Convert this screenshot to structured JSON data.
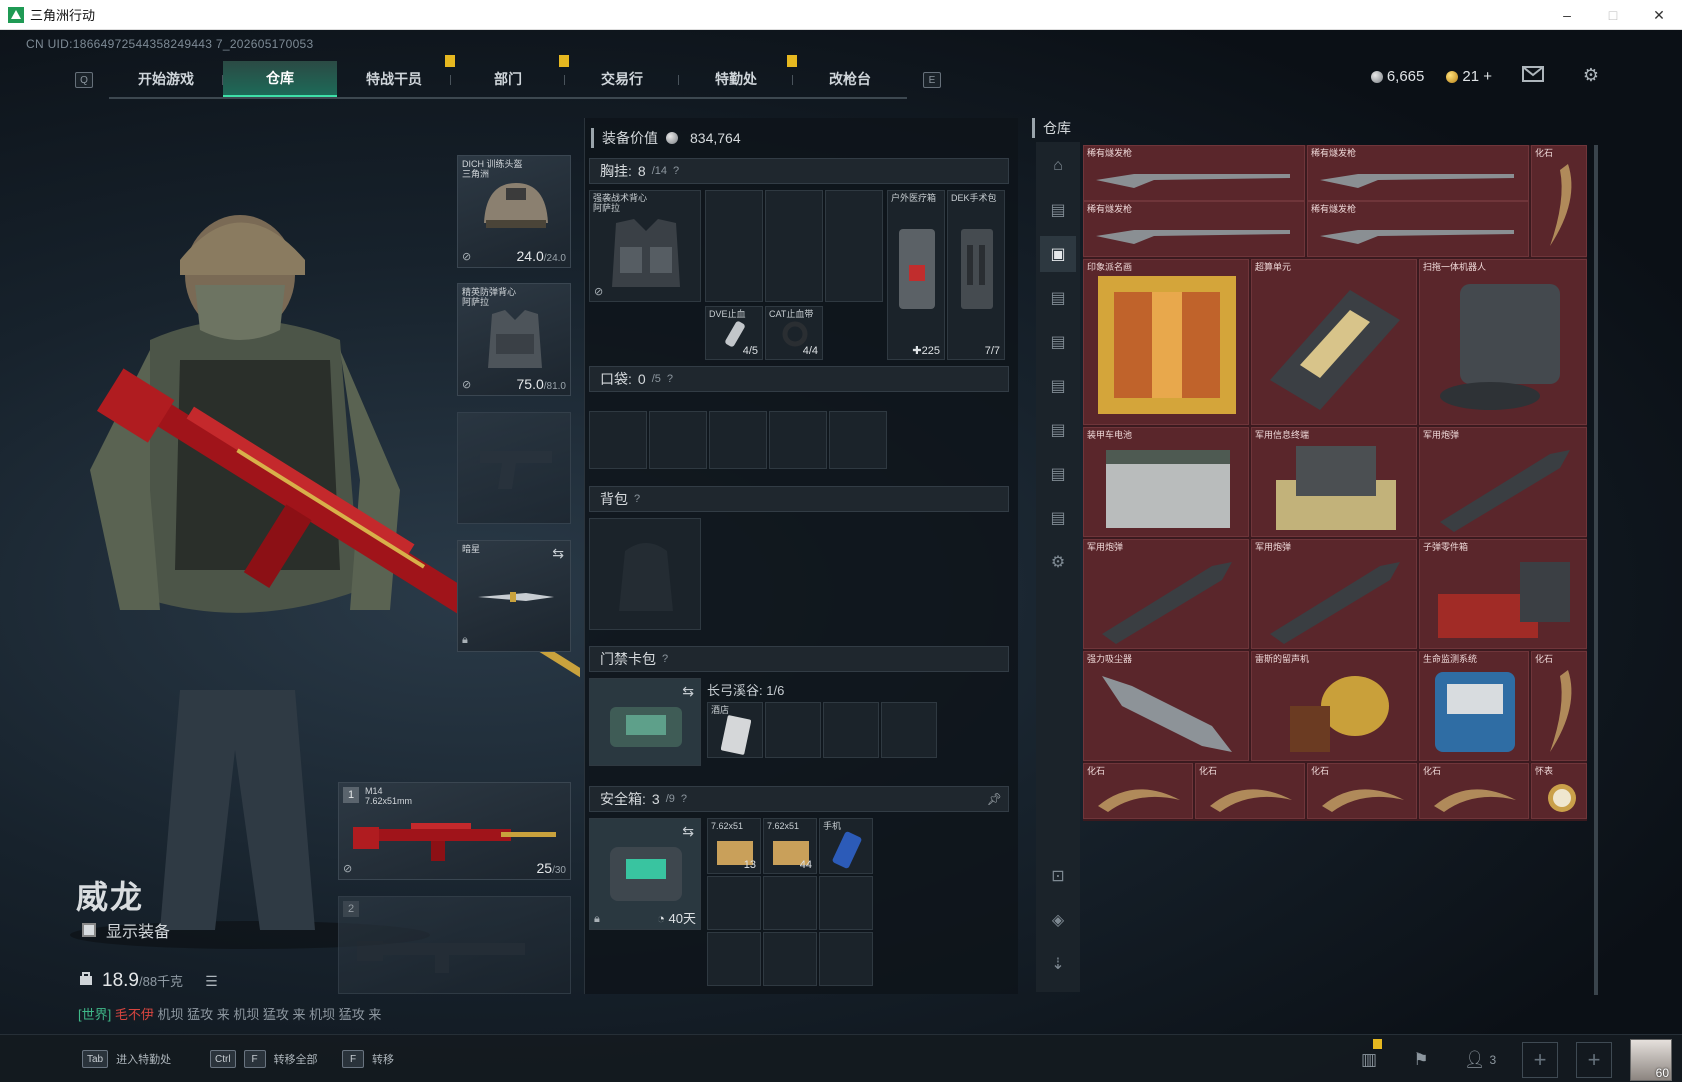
{
  "window": {
    "title": "三角洲行动",
    "controls": [
      "–",
      "□",
      "✕"
    ]
  },
  "uid": "CN UID:18664972544358249443 7_202605170053",
  "nav": {
    "left_key": "Q",
    "right_key": "E",
    "tabs": [
      {
        "label": "开始游戏",
        "active": false,
        "badge": false
      },
      {
        "label": "仓库",
        "active": true,
        "badge": false
      },
      {
        "label": "特战干员",
        "active": false,
        "badge": true
      },
      {
        "label": "部门",
        "active": false,
        "badge": true
      },
      {
        "label": "交易行",
        "active": false,
        "badge": false
      },
      {
        "label": "特勤处",
        "active": false,
        "badge": true
      },
      {
        "label": "改枪台",
        "active": false,
        "badge": false
      }
    ]
  },
  "currency": {
    "silver": "6,665",
    "gold": "21",
    "add": "+"
  },
  "top_icons": [
    "mail-icon",
    "gear-icon"
  ],
  "character": {
    "name": "威龙",
    "show_equipment": "显示装备",
    "weight": "18.9",
    "weight_max": "/88千克"
  },
  "chat": {
    "channel": "[世界]",
    "who": "毛不伊",
    "text": " 机坝 猛攻 来 机坝 猛攻 来 机坝 猛攻 来"
  },
  "equip_slots": {
    "helmet": {
      "name": "DICH 训练头盔",
      "sub": "三角洲",
      "durability": "24.0",
      "max": "/24.0"
    },
    "armor": {
      "name": "精英防弹背心",
      "sub": "阿萨拉",
      "durability": "75.0",
      "max": "/81.0"
    },
    "melee": {
      "name": "暗星"
    },
    "primary": {
      "index": "1",
      "name": "M14",
      "caliber": "7.62x51mm",
      "ammo": "25",
      "ammo_max": "/30"
    },
    "secondary": {
      "index": "2"
    }
  },
  "loadout": {
    "value_label": "装备价值",
    "value": "834,764",
    "rig": {
      "label": "胸挂:",
      "count": "8",
      "max": "/14"
    },
    "rig_item": {
      "name": "强袭战术背心",
      "sub": "阿萨拉"
    },
    "rig_side": [
      {
        "name": "户外医疗箱",
        "count": "225"
      },
      {
        "name": "DEK手术包",
        "count": "7/7"
      }
    ],
    "rig_small": [
      {
        "name": "DVE止血",
        "count": "4/5"
      },
      {
        "name": "CAT止血带",
        "count": "4/4"
      }
    ],
    "pocket": {
      "label": "口袋:",
      "count": "0",
      "max": "/5"
    },
    "backpack": {
      "label": "背包"
    },
    "keycard": {
      "label": "门禁卡包",
      "map": "长弓溪谷: 1/6",
      "item": "酒店"
    },
    "safe": {
      "label": "安全箱:",
      "count": "3",
      "max": "/9",
      "time": "40天",
      "items": [
        {
          "name": "7.62x51",
          "count": "13"
        },
        {
          "name": "7.62x51",
          "count": "44"
        },
        {
          "name": "手机",
          "count": ""
        }
      ]
    }
  },
  "warehouse": {
    "title": "仓库",
    "items": [
      {
        "name": "稀有燧发枪",
        "id": "flintlock-1"
      },
      {
        "name": "稀有燧发枪",
        "id": "flintlock-2"
      },
      {
        "name": "化石",
        "id": "fossil-1"
      },
      {
        "name": "稀有燧发枪",
        "id": "flintlock-3"
      },
      {
        "name": "稀有燧发枪",
        "id": "flintlock-4"
      },
      {
        "name": "印象派名画",
        "id": "painting"
      },
      {
        "name": "超算单元",
        "id": "supercomputer"
      },
      {
        "name": "扫拖一体机器人",
        "id": "robot"
      },
      {
        "name": "装甲车电池",
        "id": "battery"
      },
      {
        "name": "军用信息终端",
        "id": "terminal"
      },
      {
        "name": "军用炮弹",
        "id": "shell-1"
      },
      {
        "name": "军用炮弹",
        "id": "shell-2"
      },
      {
        "name": "军用炮弹",
        "id": "shell-3"
      },
      {
        "name": "子弹零件箱",
        "id": "ammo-parts"
      },
      {
        "name": "强力吸尘器",
        "id": "vacuum"
      },
      {
        "name": "雷斯的留声机",
        "id": "gramophone"
      },
      {
        "name": "生命监测系统",
        "id": "life-system"
      },
      {
        "name": "化石",
        "id": "fossil-2"
      },
      {
        "name": "化石",
        "id": "fossil-3"
      },
      {
        "name": "化石",
        "id": "fossil-4"
      },
      {
        "name": "化石",
        "id": "fossil-5"
      },
      {
        "name": "化石",
        "id": "fossil-6"
      },
      {
        "name": "怀表",
        "id": "watch"
      }
    ]
  },
  "bottom": {
    "hints": [
      {
        "keys": [
          "Tab"
        ],
        "label": "进入特勤处"
      },
      {
        "keys": [
          "Ctrl",
          "F"
        ],
        "label": "转移全部"
      },
      {
        "keys": [
          "F"
        ],
        "label": "转移"
      }
    ],
    "squad_count": "3",
    "level": "60"
  },
  "colors": {
    "accent": "#3ee0a8",
    "warehouse_bg": "#5a262b",
    "badge": "#e6b820"
  }
}
